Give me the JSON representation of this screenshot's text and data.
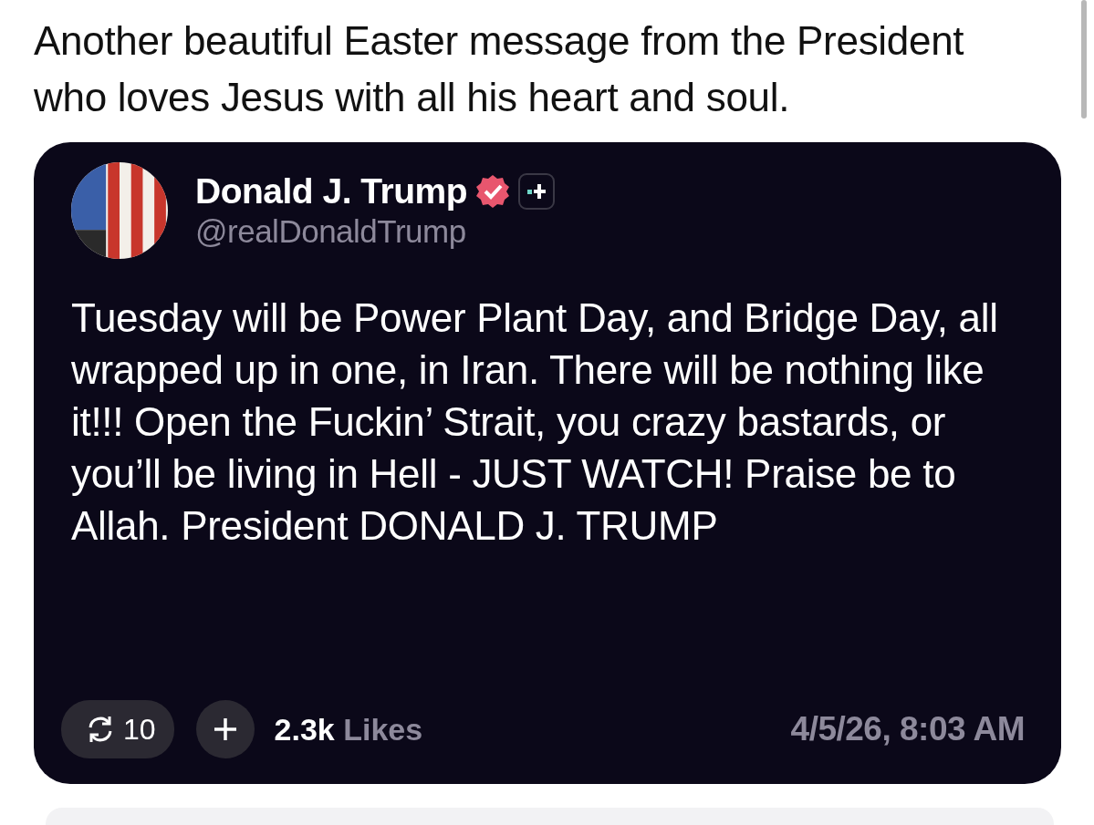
{
  "caption": "Another beautiful Easter message from the President who loves Jesus with all his heart and soul.",
  "post": {
    "author": {
      "name": "Donald J. Trump",
      "handle": "@realDonaldTrump",
      "verified": true
    },
    "body": "Tuesday will be Power Plant Day, and Bridge Day, all wrapped up in one, in Iran. There will be nothing like it!!! Open the Fuckin’ Strait, you crazy bastards, or you’ll be living in Hell - JUST WATCH! Praise be to Allah. President DONALD J. TRUMP",
    "reposts": "10",
    "likes_count": "2.3k",
    "likes_label": "Likes",
    "timestamp": "4/5/26, 8:03 AM"
  }
}
